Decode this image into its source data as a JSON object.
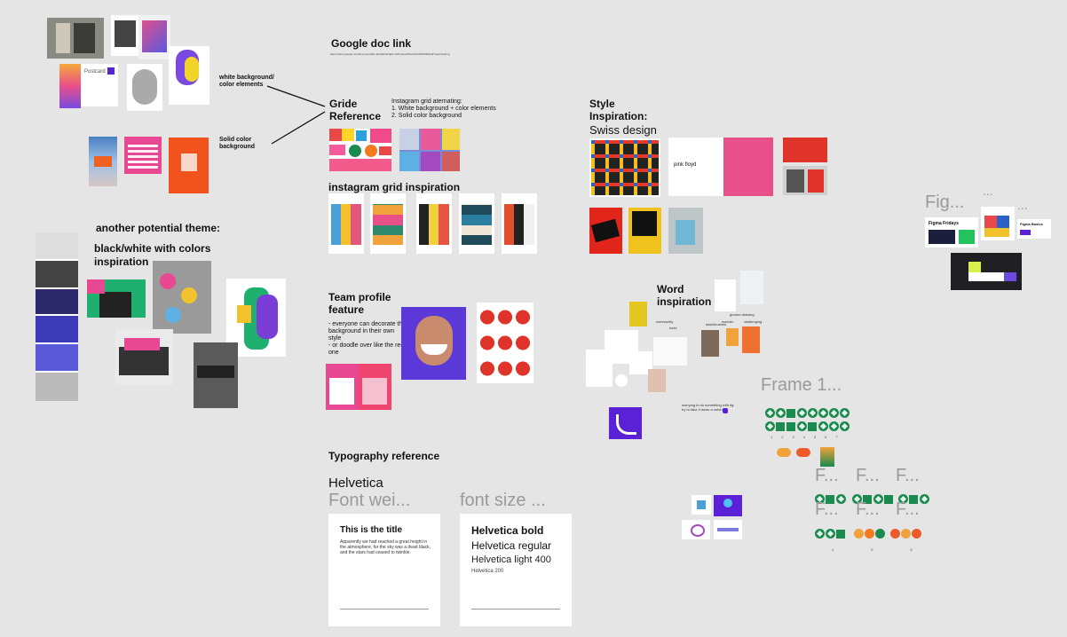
{
  "sections": {
    "google_doc": {
      "title": "Google doc link",
      "url": "https://docs.google.com/document/d/1-abcdEFGhijklmnOPqrstuvWXyz0123456789/edit?usp=sharing"
    },
    "grid_reference": {
      "title_line1": "Gride",
      "title_line2": "Reference",
      "note_line1": "Instagram grid aternating:",
      "note_line2": "1. White background + color elements",
      "note_line3": "2. Solid color background"
    },
    "white_bg_label": {
      "line1": "white background/",
      "line2": "color elements"
    },
    "solid_color_label": {
      "line1": "Solid color",
      "line2": "background"
    },
    "instagram_grid": {
      "title": "instagram grid inspiration"
    },
    "style_inspiration": {
      "line1": "Style",
      "line2": "Inspiration:",
      "sub": "Swiss design"
    },
    "another_theme": {
      "title": "another potential theme:",
      "sub_line1": "black/white with colors",
      "sub_line2": "inspiration"
    },
    "team_profile": {
      "title_line1": "Team profile",
      "title_line2": "feature",
      "bullet1_line1": "- everyone can decorate the",
      "bullet1_line2": "background in their own",
      "bullet1_line3": "style",
      "bullet2_line1": "- or doodle over like the red",
      "bullet2_line2": "one"
    },
    "word_inspiration": {
      "line1": "Word",
      "line2": "inspiration"
    },
    "typography": {
      "title": "Typography reference",
      "font_name": "Helvetica",
      "font_weight_frame": "Font wei...",
      "font_size_frame": "font size ...",
      "card1_title": "This is the title",
      "card1_body_line1": "Apparently we had reached a great height in",
      "card1_body_line2": "the atmosphere, for the sky was a dead black,",
      "card1_body_line3": "and the stars had ceased to twinkle.",
      "card2_bold": "Helvetica bold",
      "card2_regular": "Helvetica regular",
      "card2_light": "Helvetica light 400",
      "card2_small": "Helvetica 200"
    },
    "frames": {
      "fig": "Fig...",
      "dots1": "...",
      "dots2": "...",
      "frame1": "Frame 1...",
      "f1": "F...",
      "f2": "F...",
      "f3": "F...",
      "f4": "F...",
      "f5": "F...",
      "f6": "F...",
      "figma_fridays": "Figma Fridays",
      "figma_basics": "Figma Basics"
    },
    "word_notes": {
      "ground": "ground drawing",
      "community": "community",
      "wonder": "wonder",
      "tools": "tools",
      "data": "data/brushes",
      "challenging": "challenging",
      "tagline_line1": "worrying to do something with fig:",
      "tagline_line2": "try to take it down a notch"
    },
    "page_num_labels": [
      "1",
      "2",
      "3",
      "4",
      "5",
      "6",
      "7"
    ],
    "bottom_num_labels": [
      "4",
      "5",
      "6"
    ]
  },
  "colors": {
    "bg": "#e5e5e5",
    "accent_purple": "#5b21d6",
    "green_icon": "#1a8a4e",
    "pink": "#e8508a",
    "orange": "#f0501e"
  }
}
